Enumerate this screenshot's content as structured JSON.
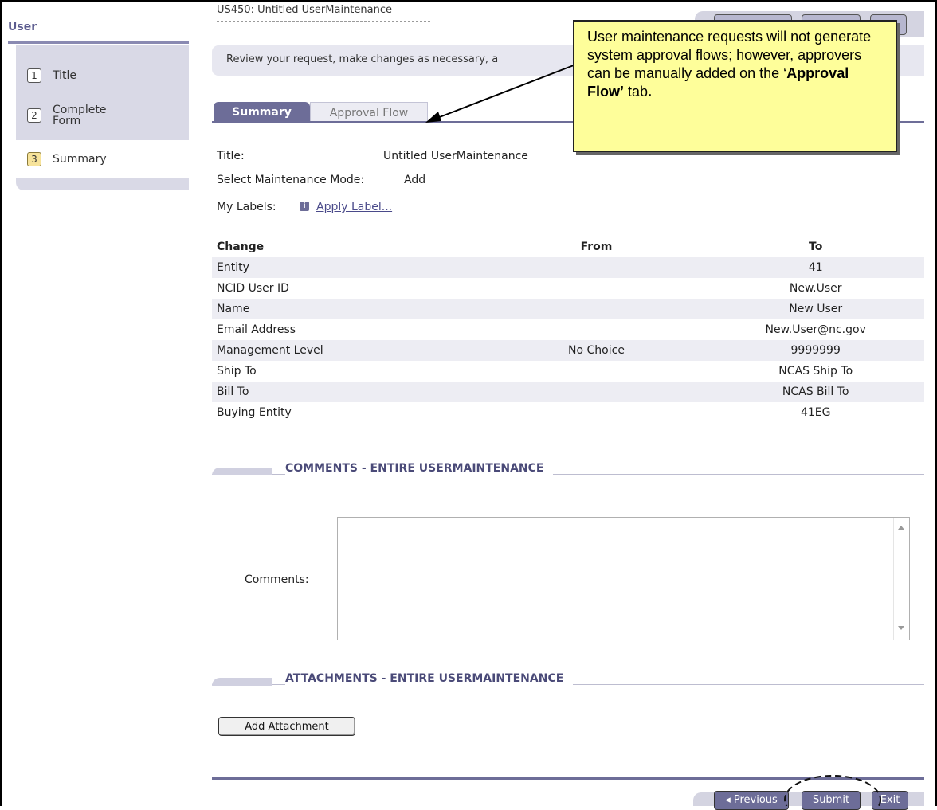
{
  "sidebar": {
    "title": "User",
    "steps": [
      {
        "num": "1",
        "label": "Title",
        "active": false
      },
      {
        "num": "2",
        "label": "Complete Form",
        "active": false
      },
      {
        "num": "3",
        "label": "Summary",
        "active": true
      }
    ]
  },
  "header": {
    "request_title": "US450: Untitled UserMaintenance",
    "instructions": "Review your request, make changes as necessary, a"
  },
  "tabs": [
    {
      "label": "Summary",
      "active": true
    },
    {
      "label": "Approval Flow",
      "active": false
    }
  ],
  "summary": {
    "title_label": "Title:",
    "title_value": "Untitled UserMaintenance",
    "mode_label": "Select Maintenance Mode:",
    "mode_value": "Add",
    "labels_label": "My Labels:",
    "info_icon_glyph": "i",
    "apply_label": "Apply Label..."
  },
  "table": {
    "headers": [
      "Change",
      "From",
      "To"
    ],
    "rows": [
      {
        "change": "Entity",
        "from": "",
        "to": "41"
      },
      {
        "change": "NCID User ID",
        "from": "",
        "to": "New.User"
      },
      {
        "change": "Name",
        "from": "",
        "to": "New User"
      },
      {
        "change": "Email Address",
        "from": "",
        "to": "New.User@nc.gov"
      },
      {
        "change": "Management Level",
        "from": "No Choice",
        "to": "9999999"
      },
      {
        "change": "Ship To",
        "from": "",
        "to": "NCAS Ship To"
      },
      {
        "change": "Bill To",
        "from": "",
        "to": "NCAS Bill To"
      },
      {
        "change": "Buying Entity",
        "from": "",
        "to": "41EG"
      }
    ]
  },
  "comments": {
    "section_title": "COMMENTS - ENTIRE USERMAINTENANCE",
    "label": "Comments:",
    "value": ""
  },
  "attachments": {
    "section_title": "ATTACHMENTS - ENTIRE USERMAINTENANCE",
    "add_button": "Add Attachment"
  },
  "footer": {
    "previous": "◂ Previous",
    "submit": "Submit",
    "exit": "Exit"
  },
  "callout": {
    "text_before": "User maintenance requests will not generate system approval flows; however, approvers can be manually added on the ‘",
    "bold": "Approval Flow’",
    "text_after": " tab",
    "period": "."
  },
  "colors": {
    "accent": "#6d6d98",
    "sidebar_panel": "#d9d9e6",
    "callout_bg": "#fefe9a",
    "active_step_badge": "#f7e39a"
  }
}
